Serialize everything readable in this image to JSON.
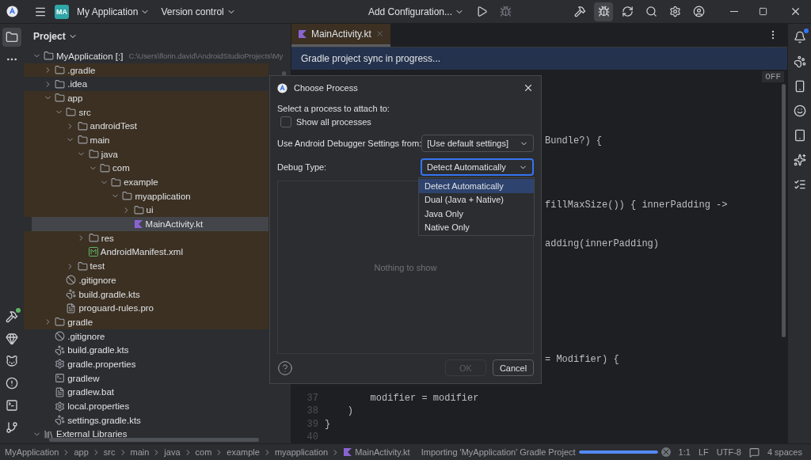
{
  "title_bar": {
    "project_badge": "MA",
    "project": "My Application",
    "vcs": "Version control",
    "run_config": "Add Configuration...",
    "tools": [
      {
        "kind": "run",
        "selected": false,
        "disabled": false
      },
      {
        "kind": "debug",
        "selected": false,
        "disabled": true
      },
      {
        "kind": "build",
        "selected": false,
        "disabled": false
      },
      {
        "kind": "attach",
        "selected": true,
        "disabled": false
      },
      {
        "kind": "sync",
        "selected": false,
        "disabled": false
      },
      {
        "kind": "search",
        "selected": false,
        "disabled": false
      },
      {
        "kind": "settings",
        "selected": false,
        "disabled": false
      },
      {
        "kind": "account",
        "selected": false,
        "disabled": false
      }
    ]
  },
  "left_toolbar": {
    "top": [
      {
        "kind": "project",
        "selected": true,
        "notification": false
      },
      {
        "kind": "more",
        "selected": false,
        "notification": false
      }
    ],
    "bottom": [
      {
        "kind": "build",
        "selected": false,
        "notification": true
      },
      {
        "kind": "gem",
        "selected": false,
        "notification": false
      },
      {
        "kind": "logcat",
        "selected": false,
        "notification": false
      },
      {
        "kind": "problems",
        "selected": false,
        "notification": false
      },
      {
        "kind": "terminal",
        "selected": false,
        "notification": false
      },
      {
        "kind": "git",
        "selected": false,
        "notification": false
      }
    ]
  },
  "right_toolbar": [
    {
      "kind": "notifications",
      "notification": true
    },
    {
      "kind": "gradle",
      "notification": false
    },
    {
      "kind": "device",
      "notification": false
    },
    {
      "kind": "emoji",
      "notification": false
    },
    {
      "kind": "mirror",
      "notification": false
    },
    {
      "kind": "ai",
      "notification": false
    },
    {
      "kind": "list",
      "notification": false
    }
  ],
  "project_panel": {
    "title": "Project",
    "tree": [
      {
        "label": "MyApplication [:]",
        "path": "C:\\Users\\florin.david\\AndroidStudioProjects\\My",
        "kind": "module",
        "expanded": true,
        "selected": false,
        "highlighted": false,
        "children": [
          {
            "label": ".gradle",
            "kind": "folder",
            "expanded": false,
            "selected": false,
            "highlighted": true
          },
          {
            "label": ".idea",
            "kind": "folder",
            "expanded": false,
            "selected": false,
            "highlighted": false
          },
          {
            "label": "app",
            "kind": "folder",
            "expanded": true,
            "selected": false,
            "highlighted": true,
            "children": [
              {
                "label": "src",
                "kind": "folder",
                "expanded": true,
                "selected": false,
                "highlighted": true,
                "children": [
                  {
                    "label": "androidTest",
                    "kind": "folder",
                    "expanded": false,
                    "selected": false,
                    "highlighted": true
                  },
                  {
                    "label": "main",
                    "kind": "folder",
                    "expanded": true,
                    "selected": false,
                    "highlighted": true,
                    "children": [
                      {
                        "label": "java",
                        "kind": "folder",
                        "expanded": true,
                        "selected": false,
                        "highlighted": true,
                        "children": [
                          {
                            "label": "com",
                            "kind": "folder",
                            "expanded": true,
                            "selected": false,
                            "highlighted": true,
                            "children": [
                              {
                                "label": "example",
                                "kind": "folder",
                                "expanded": true,
                                "selected": false,
                                "highlighted": true,
                                "children": [
                                  {
                                    "label": "myapplication",
                                    "kind": "folder",
                                    "expanded": true,
                                    "selected": false,
                                    "highlighted": true,
                                    "children": [
                                      {
                                        "label": "ui",
                                        "kind": "folder",
                                        "expanded": false,
                                        "selected": false,
                                        "highlighted": true
                                      },
                                      {
                                        "label": "MainActivity.kt",
                                        "kind": "kotlin",
                                        "selected": true,
                                        "highlighted": true
                                      }
                                    ]
                                  }
                                ]
                              }
                            ]
                          }
                        ]
                      },
                      {
                        "label": "res",
                        "kind": "folder",
                        "expanded": false,
                        "selected": false,
                        "highlighted": true
                      },
                      {
                        "label": "AndroidManifest.xml",
                        "kind": "manifest",
                        "selected": false,
                        "highlighted": true
                      }
                    ]
                  },
                  {
                    "label": "test",
                    "kind": "folder",
                    "expanded": false,
                    "selected": false,
                    "highlighted": true
                  }
                ]
              },
              {
                "label": ".gitignore",
                "kind": "ignore",
                "selected": false,
                "highlighted": true
              },
              {
                "label": "build.gradle.kts",
                "kind": "gradle",
                "selected": false,
                "highlighted": true
              },
              {
                "label": "proguard-rules.pro",
                "kind": "text",
                "selected": false,
                "highlighted": true
              }
            ]
          },
          {
            "label": "gradle",
            "kind": "folder",
            "expanded": false,
            "selected": false,
            "highlighted": true
          },
          {
            "label": ".gitignore",
            "kind": "ignore",
            "selected": false,
            "highlighted": false
          },
          {
            "label": "build.gradle.kts",
            "kind": "gradle",
            "selected": false,
            "highlighted": false
          },
          {
            "label": "gradle.properties",
            "kind": "settings",
            "selected": false,
            "highlighted": false
          },
          {
            "label": "gradlew",
            "kind": "terminal",
            "selected": false,
            "highlighted": false
          },
          {
            "label": "gradlew.bat",
            "kind": "text",
            "selected": false,
            "highlighted": false
          },
          {
            "label": "local.properties",
            "kind": "settings",
            "selected": false,
            "highlighted": false
          },
          {
            "label": "settings.gradle.kts",
            "kind": "gradle",
            "selected": false,
            "highlighted": false
          }
        ]
      },
      {
        "label": "External Libraries",
        "kind": "library",
        "expanded": true,
        "selected": false,
        "highlighted": false
      }
    ]
  },
  "editor": {
    "tabs": [
      {
        "label": "MainActivity.kt",
        "selected": true
      }
    ],
    "banner": "Gradle project sync in progress...",
    "inlay": "OFF",
    "rows": [
      {},
      {},
      {},
      {},
      {},
      {
        "kind": "tail",
        "code": "Bundle?) {"
      },
      {},
      {},
      {},
      {},
      {
        "kind": "tail",
        "code": "fillMaxSize()) { innerPadding ->"
      },
      {},
      {},
      {
        "kind": "tail",
        "code": "adding(innerPadding)"
      },
      {},
      {},
      {},
      {},
      {},
      {},
      {},
      {},
      {
        "kind": "tail",
        "code": "= Modifier) {"
      },
      {},
      {},
      {
        "kind": "line",
        "number": "37",
        "code": "        modifier = modifier"
      },
      {
        "kind": "line",
        "number": "38",
        "code": "    )"
      },
      {
        "kind": "line",
        "number": "39",
        "code": "}"
      },
      {
        "kind": "line",
        "number": "40"
      }
    ]
  },
  "dialog": {
    "title": "Choose Process",
    "prompt": "Select a process to attach to:",
    "show_all": {
      "label": "Show all processes",
      "checked": false
    },
    "fields": [
      {
        "label": "Use Android Debugger Settings from:",
        "value": "[Use default settings]",
        "focused": false
      },
      {
        "label": "Debug Type:",
        "value": "Detect Automatically",
        "focused": true
      }
    ],
    "empty_text": "Nothing to show",
    "dropdown": [
      {
        "label": "Detect Automatically",
        "selected": true
      },
      {
        "label": "Dual (Java + Native)",
        "selected": false
      },
      {
        "label": "Java Only",
        "selected": false
      },
      {
        "label": "Native Only",
        "selected": false
      }
    ],
    "buttons": [
      {
        "label": "OK",
        "disabled": true
      },
      {
        "label": "Cancel",
        "disabled": false
      }
    ]
  },
  "status_bar": {
    "breadcrumbs": [
      {
        "label": "MyApplication",
        "kind": "text"
      },
      {
        "label": "app",
        "kind": "text"
      },
      {
        "label": "src",
        "kind": "text"
      },
      {
        "label": "main",
        "kind": "text"
      },
      {
        "label": "java",
        "kind": "text"
      },
      {
        "label": "com",
        "kind": "text"
      },
      {
        "label": "example",
        "kind": "text"
      },
      {
        "label": "myapplication",
        "kind": "text"
      },
      {
        "label": "MainActivity.kt",
        "kind": "kotlin"
      }
    ],
    "task": "Importing 'MyApplication' Gradle Project",
    "progress": {
      "level": 1
    },
    "items": [
      {
        "kind": "text",
        "label": "1:1"
      },
      {
        "kind": "text",
        "label": "LF"
      },
      {
        "kind": "text",
        "label": "UTF-8"
      },
      {
        "kind": "icon"
      },
      {
        "kind": "text",
        "label": "4 spaces"
      }
    ]
  }
}
